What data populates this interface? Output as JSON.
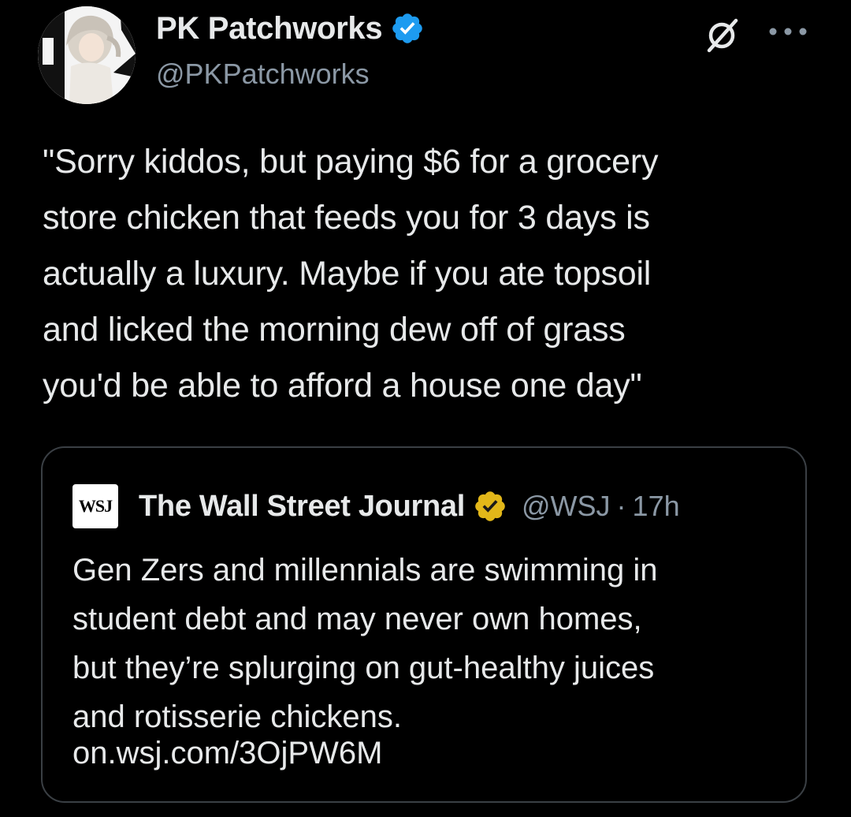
{
  "author": {
    "display_name": "PK Patchworks",
    "handle": "@PKPatchworks",
    "verified": "blue",
    "avatar_icon": "anime-girl-avatar"
  },
  "header_actions": {
    "grok_icon": "grok-slash-icon",
    "more_icon": "more-dots-icon"
  },
  "tweet": {
    "text": "\"Sorry kiddos, but paying $6 for a grocery\nstore chicken that feeds you for 3 days is\nactually a luxury. Maybe if you ate topsoil\nand licked the morning dew off of grass\nyou'd be able to afford a house one day\""
  },
  "quote": {
    "logo_text": "WSJ",
    "display_name": "The Wall Street Journal",
    "verified": "gold",
    "handle": "@WSJ",
    "separator": "·",
    "time": "17h",
    "text": "Gen Zers and millennials are swimming in\nstudent debt and may never own homes,\nbut they’re splurging on gut-healthy juices\nand rotisserie chickens.",
    "link": "on.wsj.com/3OjPW6M"
  },
  "colors": {
    "background": "#000000",
    "text_primary": "#e7e9ea",
    "text_secondary": "#8b98a5",
    "verified_blue": "#1d9bf0",
    "verified_gold": "#e2b719",
    "card_border": "#3a3f44"
  }
}
